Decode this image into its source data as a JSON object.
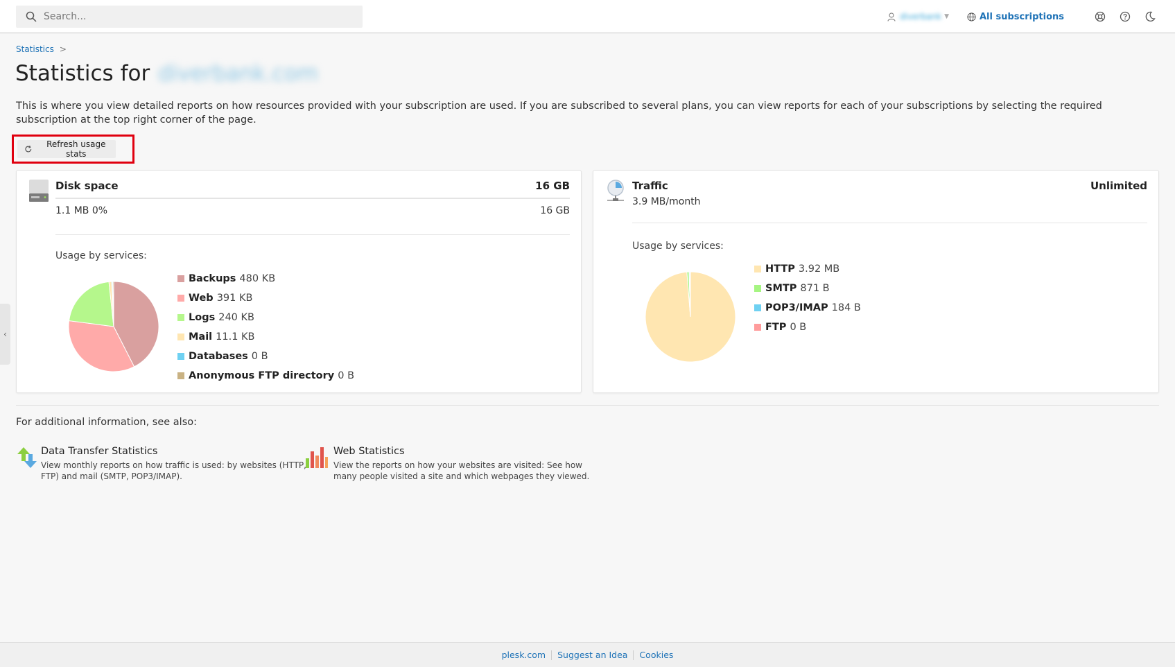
{
  "search": {
    "placeholder": "Search..."
  },
  "header": {
    "user_name": "diverbank",
    "subscriptions_label": "All subscriptions"
  },
  "breadcrumb": {
    "item": "Statistics",
    "separator": ">"
  },
  "page": {
    "title_prefix": "Statistics for",
    "title_domain": "diverbank.com",
    "intro": "This is where you view detailed reports on how resources provided with your subscription are used. If you are subscribed to several plans, you can view reports for each of your subscriptions by selecting the required subscription at the top right corner of the page.",
    "refresh_label": "Refresh usage stats"
  },
  "disk": {
    "title": "Disk space",
    "total": "16 GB",
    "used_text": "1.1 MB 0%",
    "limit_text": "16 GB",
    "usage_fraction": 0,
    "usage_label": "Usage by services:",
    "legend": [
      {
        "name": "Backups",
        "value": "480 KB",
        "color": "#d9a09f"
      },
      {
        "name": "Web",
        "value": "391 KB",
        "color": "#ffaaa9"
      },
      {
        "name": "Logs",
        "value": "240 KB",
        "color": "#b5f78c"
      },
      {
        "name": "Mail",
        "value": "11.1 KB",
        "color": "#ffe6b1"
      },
      {
        "name": "Databases",
        "value": "0 B",
        "color": "#6fd1f2"
      },
      {
        "name": "Anonymous FTP directory",
        "value": "0 B",
        "color": "#c9b283"
      }
    ]
  },
  "traffic": {
    "title": "Traffic",
    "total": "Unlimited",
    "used_text": "3.9 MB/month",
    "usage_label": "Usage by services:",
    "legend": [
      {
        "name": "HTTP",
        "value": "3.92 MB",
        "color": "#ffe6b1"
      },
      {
        "name": "SMTP",
        "value": "871 B",
        "color": "#a6f582"
      },
      {
        "name": "POP3/IMAP",
        "value": "184 B",
        "color": "#6fd1f2"
      },
      {
        "name": "FTP",
        "value": "0 B",
        "color": "#ff9c9c"
      }
    ]
  },
  "chart_data": [
    {
      "type": "pie",
      "categories": [
        "Backups",
        "Web",
        "Logs",
        "Mail",
        "Databases",
        "Anonymous FTP directory"
      ],
      "values": [
        480,
        391,
        240,
        11.1,
        4,
        4
      ],
      "colors": [
        "#d9a09f",
        "#ffaaa9",
        "#b5f78c",
        "#ffe6b1",
        "#6fd1f2",
        "#c9b283"
      ]
    },
    {
      "type": "pie",
      "categories": [
        "HTTP",
        "SMTP",
        "POP3/IMAP",
        "FTP"
      ],
      "values": [
        3920,
        30,
        12,
        8
      ],
      "colors": [
        "#ffe6b1",
        "#a6f582",
        "#6fd1f2",
        "#ff9c9c"
      ]
    }
  ],
  "see_also": {
    "label": "For additional information, see also:",
    "items": [
      {
        "title": "Data Transfer Statistics",
        "description_1": "View monthly reports on how traffic is used: by websites (HTTP,",
        "description_2": "FTP) and mail (SMTP, POP3/IMAP)."
      },
      {
        "title": "Web Statistics",
        "description_1": "View the reports on how your websites are visited: See how",
        "description_2": "many people visited a site and which webpages they viewed."
      }
    ]
  },
  "footer": {
    "links": [
      "plesk.com",
      "Suggest an Idea",
      "Cookies"
    ]
  }
}
